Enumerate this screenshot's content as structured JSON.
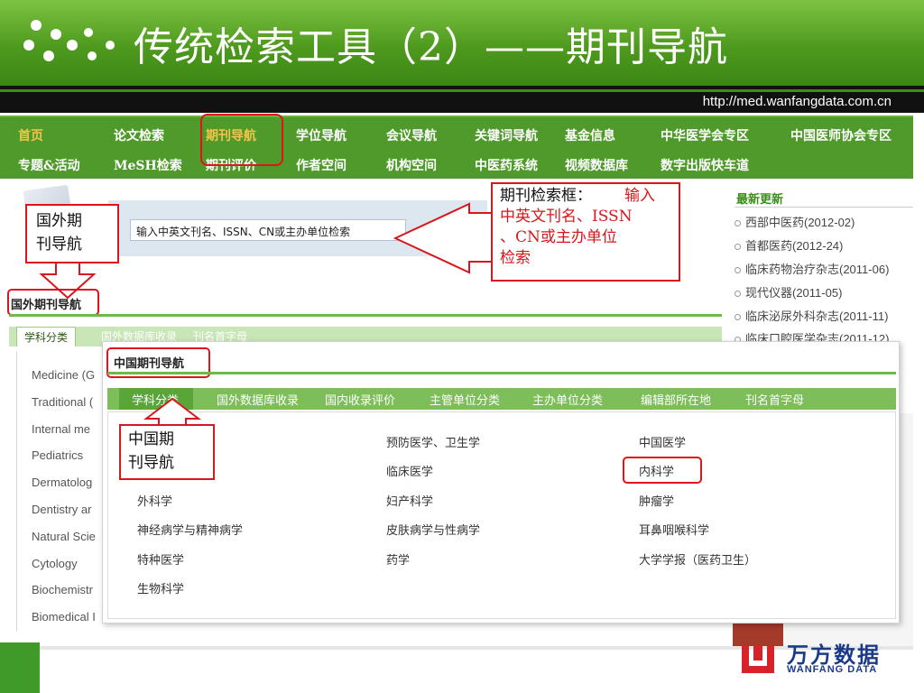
{
  "slide": {
    "title": "传统检索工具（2）——期刊导航",
    "url": "http://med.wanfangdata.com.cn"
  },
  "nav": {
    "row1": [
      "首页",
      "论文检索",
      "期刊导航",
      "学位导航",
      "会议导航",
      "关键词导航",
      "基金信息",
      "中华医学会专区",
      "中国医师协会专区"
    ],
    "row2": [
      "专题&活动",
      "MeSH检索",
      "期刊评价",
      "作者空间",
      "机构空间",
      "中医药系统",
      "视频数据库",
      "数字出版快车道"
    ]
  },
  "search": {
    "placeholder": "输入中英文刊名、ISSN、CN或主办单位检索"
  },
  "callouts": {
    "search_label": "期刊检索框：",
    "search_desc_1": "输入",
    "search_desc_2": "中英文刊名、ISSN",
    "search_desc_3": "、CN或主办单位",
    "search_desc_4": "检索",
    "foreign_1": "国外期",
    "foreign_2": "刊导航",
    "china_1": "中国期",
    "china_2": "刊导航"
  },
  "foreign": {
    "title": "国外期刊导航",
    "tabs": [
      "学科分类",
      "国外数据库收录",
      "刊名首字母"
    ],
    "list": [
      "Medicine (G",
      "Traditional (",
      "Internal me",
      "Pediatrics",
      "Dermatolog",
      "Dentistry ar",
      "Natural Scie",
      "Cytology",
      "Biochemistr",
      "Biomedical I"
    ]
  },
  "sidebar": {
    "title": "最新更新",
    "items": [
      "西部中医药(2012-02)",
      "首都医药(2012-24)",
      "临床药物治疗杂志(2011-06)",
      "现代仪器(2011-05)",
      "临床泌尿外科杂志(2011-11)",
      "临床口腔医学杂志(2011-12)"
    ]
  },
  "china": {
    "title": "中国期刊导航",
    "tabs": [
      "学科分类",
      "国外数据库收录",
      "国内收录评价",
      "主管单位分类",
      "主办单位分类",
      "编辑部所在地",
      "刊名首字母"
    ],
    "col1": [
      "",
      "",
      "外科学",
      "神经病学与精神病学",
      "特种医学",
      "生物科学"
    ],
    "col2": [
      "预防医学、卫生学",
      "临床医学",
      "妇产科学",
      "皮肤病学与性病学",
      "药学"
    ],
    "col3": [
      "中国医学",
      "内科学",
      "肿瘤学",
      "耳鼻咽喉科学",
      "大学学报（医药卫生）"
    ]
  },
  "logo": {
    "cn": "万方数据",
    "en": "WANFANG DATA"
  },
  "colors": {
    "header_green": "#4e9a1e",
    "nav_green": "#4f9a2a",
    "highlight_red": "#e0141a",
    "callout_red": "#d9161c",
    "logo_blue": "#1a3a8a"
  }
}
